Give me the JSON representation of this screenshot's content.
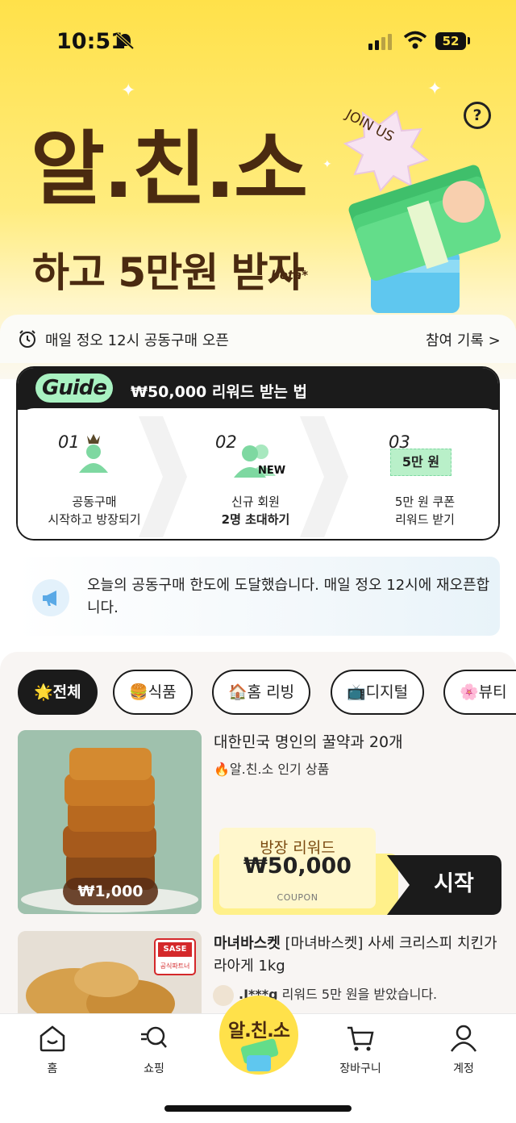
{
  "status": {
    "time": "10:51",
    "battery": "52"
  },
  "hero": {
    "title": "알.친.소",
    "subtitle": "하고 5만원 받자",
    "beta": "beta*",
    "help": "?",
    "badge": "JOIN US"
  },
  "notice": {
    "text": "매일 정오 12시 공동구매 오픈",
    "history_link": "참여 기록 >"
  },
  "guide": {
    "badge": "Guide",
    "title": "₩50,000 리워드 받는 법",
    "steps": [
      {
        "num": "01",
        "line1": "공동구매",
        "line2": "시작하고 방장되기"
      },
      {
        "num": "02",
        "line1": "신규 회원",
        "line2": "2명 초대하기",
        "badge": "NEW"
      },
      {
        "num": "03",
        "line1": "5만 원 쿠폰",
        "line2": "리워드 받기",
        "badge": "5만 원"
      }
    ]
  },
  "limit_notice": "오늘의 공동구매 한도에 도달했습니다. 매일 정오 12시에 재오픈합니다.",
  "categories": [
    {
      "emoji": "🌟",
      "label": "전체"
    },
    {
      "emoji": "🍔",
      "label": "식품"
    },
    {
      "emoji": "🏠",
      "label": "홈 리빙"
    },
    {
      "emoji": "📺",
      "label": "디지털"
    },
    {
      "emoji": "🌸",
      "label": "뷰티"
    }
  ],
  "products": [
    {
      "title": "대한민국 명인의 꿀약과 20개",
      "tag": "🔥알.친.소 인기 상품",
      "price": "₩1,000",
      "reward_label": "방장 리워드",
      "reward_amount": "₩50,000",
      "coupon": "COUPON",
      "cta": "시작"
    },
    {
      "brand": "마녀바스켓",
      "title": " [마녀바스켓] 사세 크리스피 치킨가라아게 1kg",
      "review_user": ".I***g",
      "review_text": " 리워드 5만 원을 받았습니다.",
      "img_brand": "SASE",
      "img_sub": "공식파트너"
    }
  ],
  "tabs": {
    "home": "홈",
    "shopping": "쇼핑",
    "center": "알.친.소",
    "cart": "장바구니",
    "account": "계정"
  },
  "colors": {
    "brand_yellow": "#ffe14a",
    "brand_brown": "#4a2a10",
    "guide_green": "#a9f2c2",
    "dark": "#1b1b1b"
  }
}
